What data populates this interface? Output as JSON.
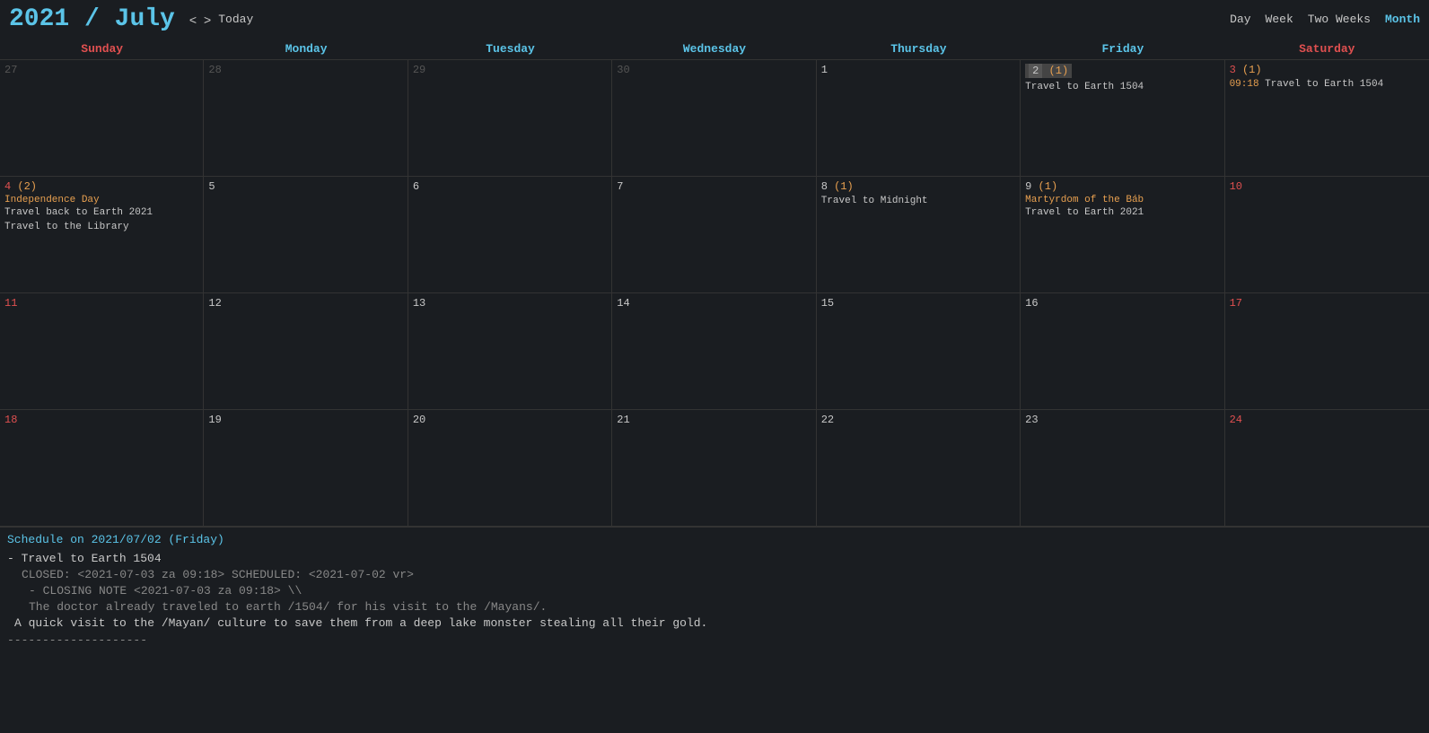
{
  "header": {
    "year": "2021",
    "slash": " / ",
    "month": "July",
    "nav": {
      "prev": "<",
      "next": ">",
      "today": "Today"
    },
    "views": [
      "Day",
      "Week",
      "Two Weeks",
      "Month"
    ],
    "active_view": "Month"
  },
  "day_headers": [
    {
      "label": "Sunday",
      "type": "sun"
    },
    {
      "label": "Monday",
      "type": "weekday"
    },
    {
      "label": "Tuesday",
      "type": "weekday"
    },
    {
      "label": "Wednesday",
      "type": "weekday"
    },
    {
      "label": "Thursday",
      "type": "weekday"
    },
    {
      "label": "Friday",
      "type": "weekday"
    },
    {
      "label": "Saturday",
      "type": "sat"
    }
  ],
  "weeks": [
    [
      {
        "day": "27",
        "faded": true,
        "baha": "",
        "events": []
      },
      {
        "day": "28",
        "faded": true,
        "baha": "",
        "events": []
      },
      {
        "day": "29",
        "faded": true,
        "baha": "",
        "events": []
      },
      {
        "day": "30",
        "faded": true,
        "baha": "",
        "events": []
      },
      {
        "day": "1",
        "faded": false,
        "baha": "",
        "events": []
      },
      {
        "day": "2",
        "baha": "(1)",
        "today": true,
        "events": [
          {
            "text": "Travel to Earth 1504",
            "time": ""
          }
        ]
      },
      {
        "day": "3",
        "baha": "(1)",
        "events": [
          {
            "text": "Travel to Earth 1504",
            "time": "09:18",
            "orange": true
          }
        ]
      }
    ],
    [
      {
        "day": "4",
        "baha": "(2)",
        "holiday": "Independence Day",
        "events": [
          {
            "text": "Travel back to Earth 2021"
          },
          {
            "text": "Travel to the Library"
          }
        ]
      },
      {
        "day": "5",
        "baha": "",
        "events": []
      },
      {
        "day": "6",
        "baha": "",
        "events": []
      },
      {
        "day": "7",
        "baha": "",
        "events": []
      },
      {
        "day": "8",
        "baha": "(1)",
        "events": [
          {
            "text": "Travel to Midnight"
          }
        ]
      },
      {
        "day": "9",
        "baha": "(1)",
        "holiday": "Martyrdom of the Báb",
        "events": [
          {
            "text": "Travel to Earth 2021"
          }
        ]
      },
      {
        "day": "10",
        "baha": "",
        "events": []
      }
    ],
    [
      {
        "day": "11",
        "baha": "",
        "events": []
      },
      {
        "day": "12",
        "baha": "",
        "events": []
      },
      {
        "day": "13",
        "baha": "",
        "events": []
      },
      {
        "day": "14",
        "baha": "",
        "events": []
      },
      {
        "day": "15",
        "baha": "",
        "events": []
      },
      {
        "day": "16",
        "baha": "",
        "events": []
      },
      {
        "day": "17",
        "baha": "",
        "events": []
      }
    ],
    [
      {
        "day": "18",
        "baha": "",
        "events": []
      },
      {
        "day": "19",
        "baha": "",
        "events": []
      },
      {
        "day": "20",
        "baha": "",
        "events": []
      },
      {
        "day": "21",
        "baha": "",
        "events": []
      },
      {
        "day": "22",
        "baha": "",
        "events": []
      },
      {
        "day": "23",
        "baha": "",
        "events": []
      },
      {
        "day": "24",
        "baha": "",
        "events": []
      }
    ]
  ],
  "schedule": {
    "header": "Schedule on 2021/07/02 (Friday)",
    "items": [
      {
        "title": "- Travel to Earth 1504",
        "meta": "CLOSED: <2021-07-03 za 09:18> SCHEDULED: <2021-07-02 vr>",
        "note_label": "- CLOSING NOTE <2021-07-03 za 09:18> \\\\",
        "note_body": "  The doctor already traveled to earth /1504/ for his visit to the /Mayans/.",
        "description": "  A quick visit to the /Mayan/ culture to save them from a deep lake monster stealing all their gold."
      }
    ],
    "divider": "--------------------"
  }
}
